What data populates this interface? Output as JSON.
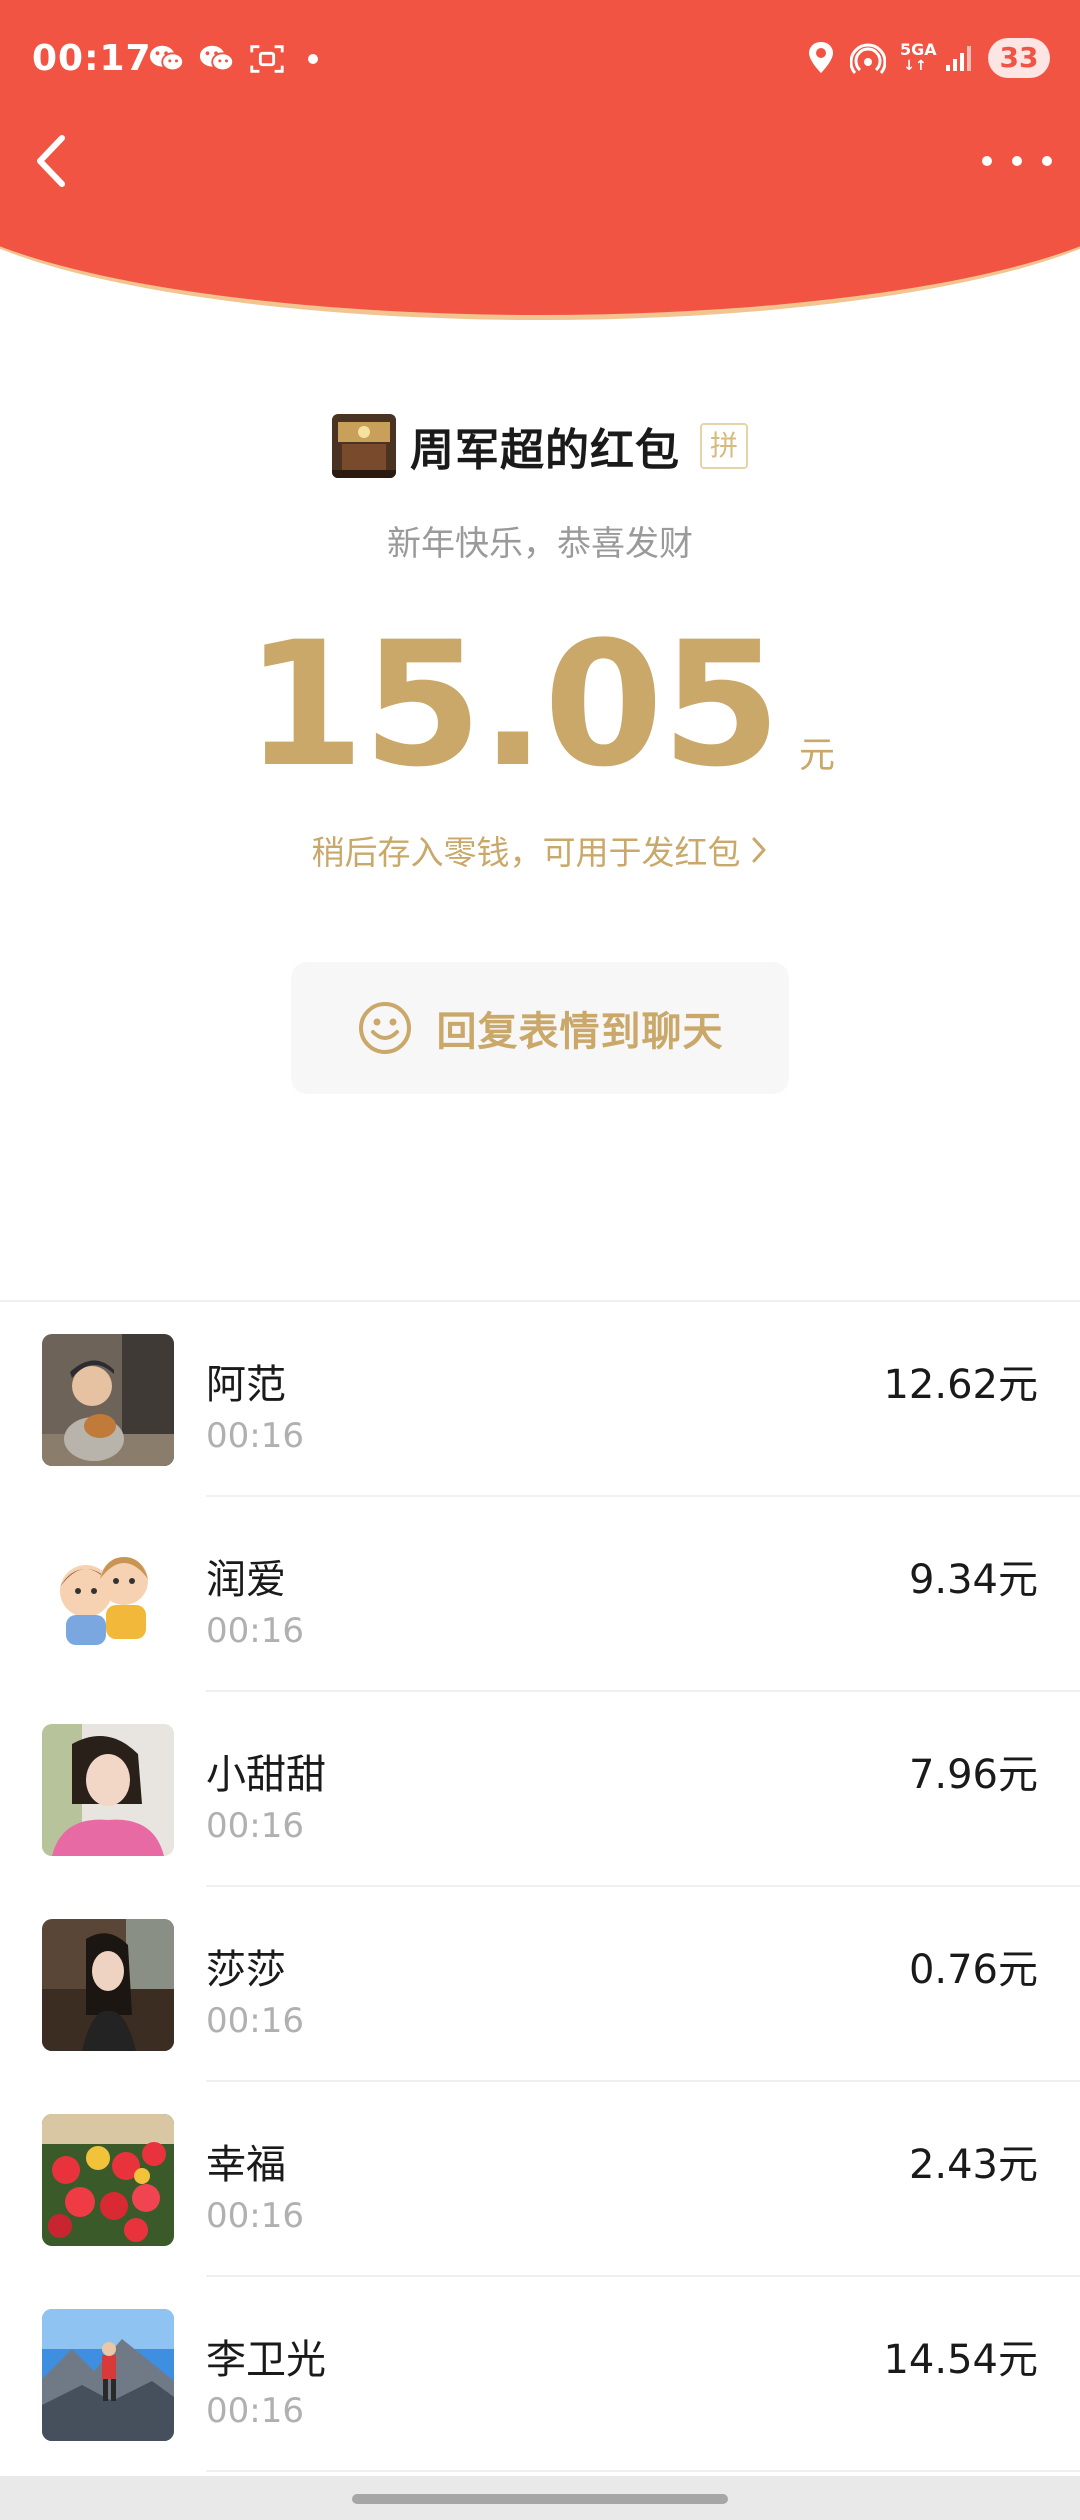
{
  "status_bar": {
    "time": "00:17",
    "network": "5GA",
    "battery": "33",
    "icons": [
      "wechat-icon",
      "wechat-icon",
      "screenshot-icon",
      "location-icon",
      "hotspot-icon",
      "signal-icon"
    ]
  },
  "header": {
    "back_icon": "chevron-left-icon",
    "more_icon": "more-dots-icon",
    "colors": {
      "red": "#f25444",
      "gold_edge": "#f2c48f"
    }
  },
  "packet": {
    "title": "周军超的红包",
    "tag": "拼",
    "greeting": "新年快乐，恭喜发财",
    "amount": "15.05",
    "currency": "元",
    "notice": "稍后存入零钱，可用于发红包",
    "reply_button": "回复表情到聊天",
    "accent_color": "#c9a86a"
  },
  "receivers": [
    {
      "name": "阿范",
      "time": "00:16",
      "amount": "12.62元"
    },
    {
      "name": "润爱",
      "time": "00:16",
      "amount": "9.34元"
    },
    {
      "name": "小甜甜",
      "time": "00:16",
      "amount": "7.96元"
    },
    {
      "name": "莎莎",
      "time": "00:16",
      "amount": "0.76元"
    },
    {
      "name": "幸福",
      "time": "00:16",
      "amount": "2.43元"
    },
    {
      "name": "李卫光",
      "time": "00:16",
      "amount": "14.54元"
    }
  ]
}
